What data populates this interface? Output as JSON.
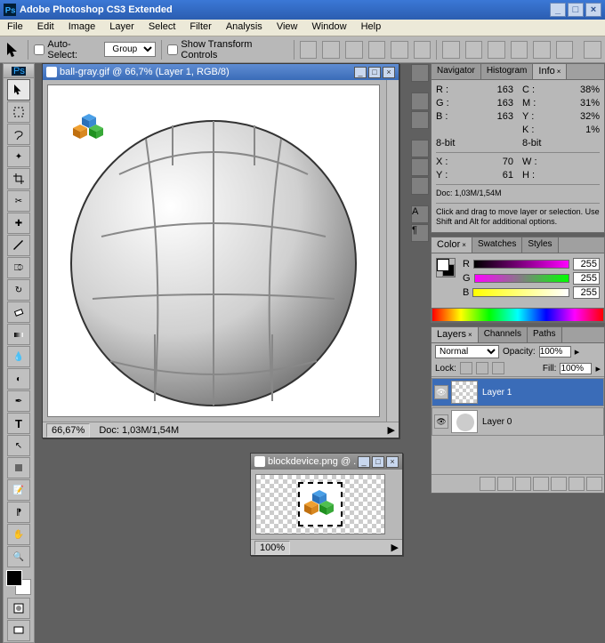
{
  "app": {
    "title": "Adobe Photoshop CS3 Extended"
  },
  "menu": [
    "File",
    "Edit",
    "Image",
    "Layer",
    "Select",
    "Filter",
    "Analysis",
    "View",
    "Window",
    "Help"
  ],
  "options": {
    "auto_select": "Auto-Select:",
    "group": "Group",
    "show_transform": "Show Transform Controls"
  },
  "doc1": {
    "title": "ball-gray.gif @ 66,7% (Layer 1, RGB/8)",
    "zoom": "66,67%",
    "docsize": "Doc: 1,03M/1,54M"
  },
  "doc2": {
    "title": "blockdevice.png @ ...",
    "zoom": "100%"
  },
  "info_panel": {
    "tabs": [
      "Navigator",
      "Histogram",
      "Info"
    ],
    "r_label": "R :",
    "r_val": "163",
    "g_label": "G :",
    "g_val": "163",
    "b_label": "B :",
    "b_val": "163",
    "c_label": "C :",
    "c_val": "38%",
    "m_label": "M :",
    "m_val": "31%",
    "y_label": "Y :",
    "y_val": "32%",
    "k_label": "K :",
    "k_val": "1%",
    "bit1": "8-bit",
    "bit2": "8-bit",
    "x_label": "X :",
    "x_val": "70",
    "yy_label": "Y :",
    "yy_val": "61",
    "w_label": "W :",
    "w_val": "",
    "h_label": "H :",
    "h_val": "",
    "docline": "Doc: 1,03M/1,54M",
    "hint": "Click and drag to move layer or selection. Use Shift and Alt for additional options."
  },
  "color_panel": {
    "tabs": [
      "Color",
      "Swatches",
      "Styles"
    ],
    "r": "R",
    "g": "G",
    "b": "B",
    "rv": "255",
    "gv": "255",
    "bv": "255"
  },
  "layers_panel": {
    "tabs": [
      "Layers",
      "Channels",
      "Paths"
    ],
    "blend": "Normal",
    "opacity_lbl": "Opacity:",
    "opacity": "100%",
    "lock_lbl": "Lock:",
    "fill_lbl": "Fill:",
    "fill": "100%",
    "l1": "Layer 1",
    "l0": "Layer 0"
  }
}
